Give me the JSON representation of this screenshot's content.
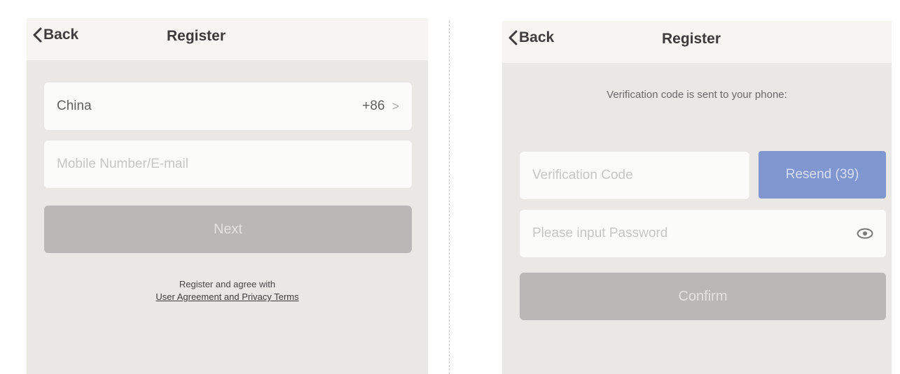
{
  "left": {
    "nav": {
      "back": "Back",
      "title": "Register"
    },
    "country": {
      "name": "China",
      "code": "+86",
      "chevron": ">"
    },
    "account_input": {
      "placeholder": "Mobile Number/E-mail",
      "value": ""
    },
    "next_button": "Next",
    "agree_text": "Register and agree with",
    "agree_link": "User Agreement and Privacy Terms"
  },
  "right": {
    "nav": {
      "back": "Back",
      "title": "Register"
    },
    "info": "Verification code is sent to your phone:",
    "code_input": {
      "placeholder": "Verification Code",
      "value": ""
    },
    "resend_button": "Resend (39)",
    "password_input": {
      "placeholder": "Please input Password",
      "value": ""
    },
    "confirm_button": "Confirm"
  },
  "icons": {
    "back": "chevron-left-icon",
    "country_arrow": "chevron-right-icon",
    "password_toggle": "eye-icon"
  },
  "colors": {
    "resend_button": "#8096cf",
    "disabled_button": "#b9b8b6",
    "background": "#e9e8e4"
  }
}
